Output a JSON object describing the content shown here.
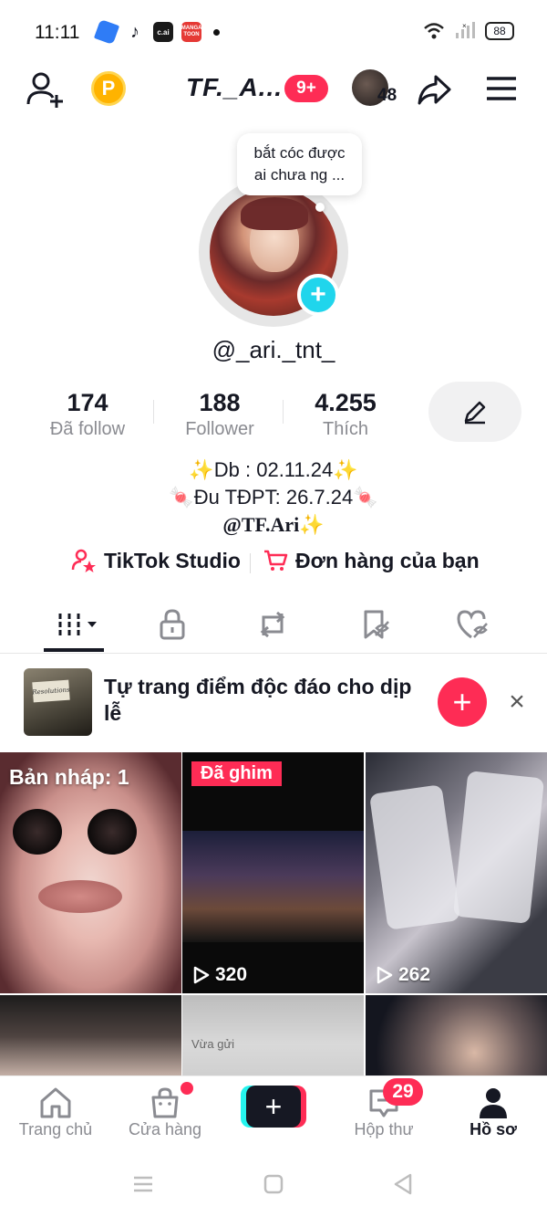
{
  "status_bar": {
    "time": "11:11",
    "apps": [
      {
        "name": "blue-app-icon",
        "label": "",
        "color": "#2f7cf6"
      },
      {
        "name": "tiktok-icon",
        "label": "",
        "color": "#161823"
      },
      {
        "name": "c-ai-icon",
        "label": "c.ai",
        "color": "#1a1a1a"
      },
      {
        "name": "manga-toon-icon",
        "label": "MANGA TOON",
        "color": "#e53935"
      }
    ],
    "battery": "88"
  },
  "header": {
    "username": "TF._A...",
    "notification_badge": "9+",
    "viewers_count": "48"
  },
  "profile": {
    "note": "bắt cóc được ai chưa ng ...",
    "handle": "@_ari._tnt_",
    "stats": [
      {
        "value": "174",
        "label": "Đã follow"
      },
      {
        "value": "188",
        "label": "Follower"
      },
      {
        "value": "4.255",
        "label": "Thích"
      }
    ],
    "bio": {
      "line1": "✨Db : 02.11.24✨",
      "line2": "🍬Đu TĐPT: 26.7.24🍬",
      "line3": "@TF.Ari✨"
    },
    "links": {
      "studio": "TikTok Studio",
      "orders": "Đơn hàng của bạn"
    }
  },
  "promo": {
    "text": "Tự trang điểm độc đáo cho dịp lễ",
    "thumb_sign": "Resolutions"
  },
  "videos": {
    "draft_label": "Bản nháp: 1",
    "pinned_label": "Đã ghim",
    "tile2_views": "320",
    "tile3_views": "262",
    "tile5_text": "Vừa gửi"
  },
  "bottom_nav": {
    "home": "Trang chủ",
    "shop": "Cửa hàng",
    "inbox": "Hộp thư",
    "inbox_badge": "29",
    "profile": "Hồ sơ"
  },
  "colors": {
    "accent": "#fe2c55",
    "cyan": "#20d5ec",
    "text": "#161823",
    "muted": "#8a8b91"
  }
}
